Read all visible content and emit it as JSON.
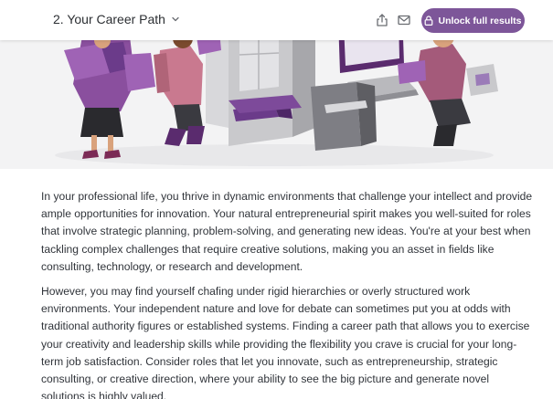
{
  "header": {
    "section_title": "2. Your Career Path",
    "unlock_label": "Unlock full results"
  },
  "body": {
    "paragraphs": [
      "In your professional life, you thrive in dynamic environments that challenge your intellect and provide ample opportunities for innovation. Your natural entrepreneurial spirit makes you well-suited for roles that involve strategic planning, problem-solving, and generating new ideas. You're at your best when tackling complex challenges that require creative solutions, making you an asset in fields like consulting, technology, or research and development.",
      "However, you may find yourself chafing under rigid hierarchies or overly structured work environments. Your independent nature and love for debate can sometimes put you at odds with traditional authority figures or established systems. Finding a career path that allows you to exercise your creativity and leadership skills while providing the flexibility you crave is crucial for your long-term job satisfaction. Consider roles that let you innovate, such as entrepreneurship, strategic consulting, or creative direction, where your ability to see the big picture and generate novel solutions is highly valued."
    ]
  },
  "colors": {
    "accent": "#7d5699",
    "text": "#30343a"
  },
  "icons": {
    "dropdown": "chevron-down-icon",
    "share": "share-icon",
    "email": "mail-icon",
    "lock": "lock-icon"
  }
}
